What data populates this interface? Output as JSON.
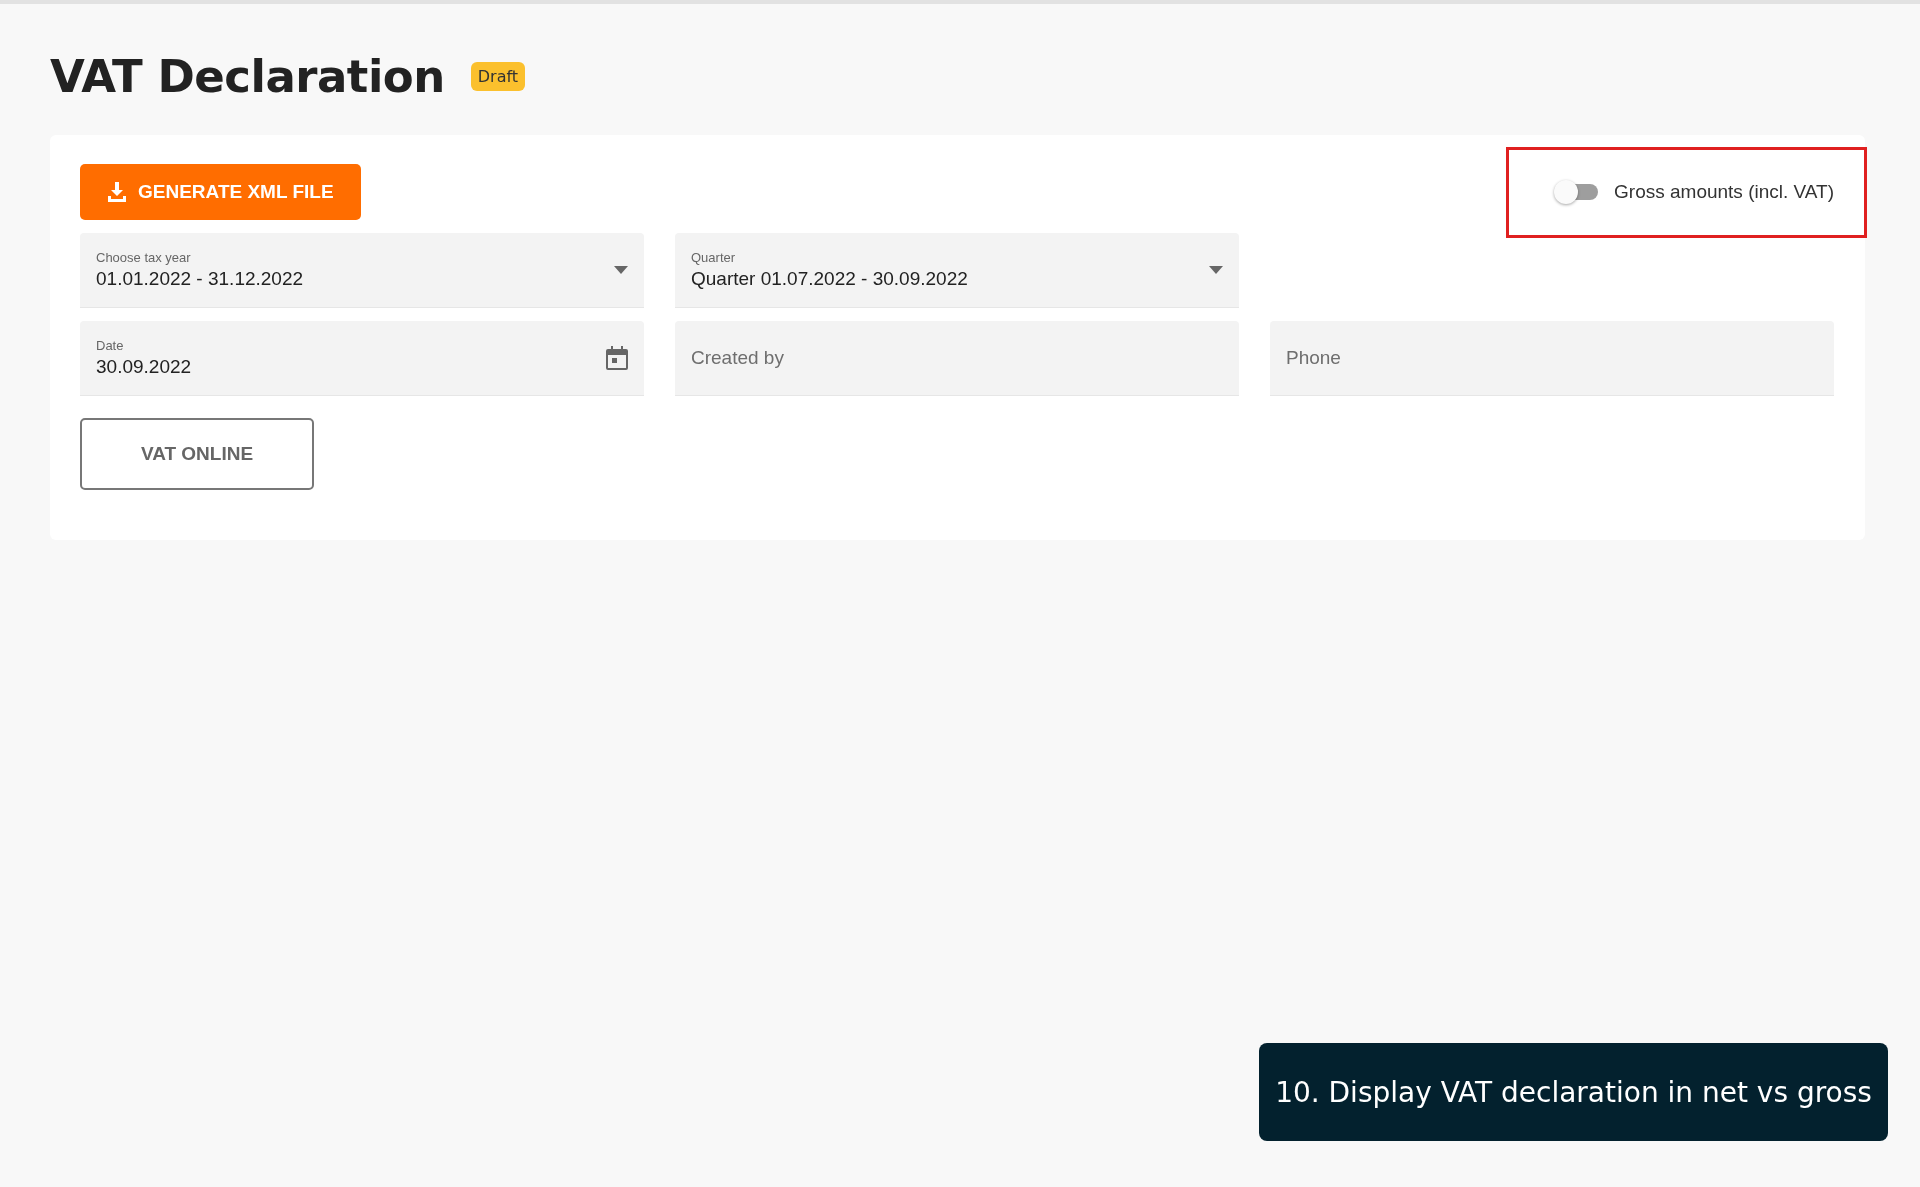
{
  "page": {
    "title": "VAT Declaration",
    "status_badge": "Draft"
  },
  "generate_button": {
    "label": "GENERATE XML FILE"
  },
  "gross_toggle": {
    "label": "Gross amounts (incl. VAT)",
    "on": false
  },
  "fields": [
    {
      "kind": "select",
      "label": "Choose tax year",
      "value": "01.01.2022 - 31.12.2022"
    },
    {
      "kind": "select",
      "label": "Quarter",
      "value": "Quarter 01.07.2022 - 30.09.2022"
    },
    {
      "kind": "date",
      "label": "Date",
      "value": "30.09.2022"
    },
    {
      "kind": "text",
      "placeholder": "Created by"
    },
    {
      "kind": "text",
      "placeholder": "Phone"
    }
  ],
  "vat_online_button": {
    "label": "VAT ONLINE"
  },
  "caption": "10. Display VAT declaration in net vs gross"
}
